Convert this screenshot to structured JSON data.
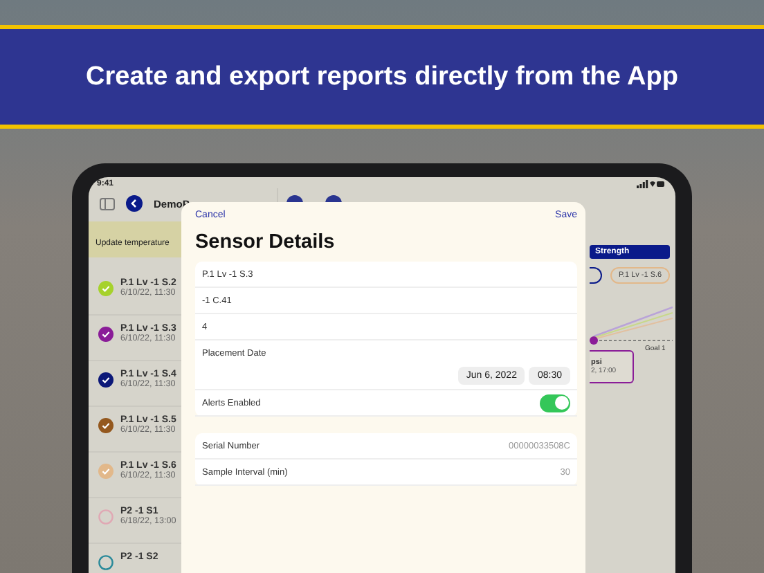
{
  "banner": {
    "title": "Create and export reports directly from the App"
  },
  "status_bar": {
    "time": "9:41"
  },
  "sidebar": {
    "title": "DemoP",
    "notice": "Update temperature",
    "sensors": [
      {
        "name": "P.1 Lv -1 S.2",
        "date": "6/10/22, 11:30",
        "color": "#a6d22c",
        "checked": true
      },
      {
        "name": "P.1 Lv -1 S.3",
        "date": "6/10/22, 11:30",
        "color": "#8a1c98",
        "checked": true
      },
      {
        "name": "P.1 Lv -1 S.4",
        "date": "6/10/22, 11:30",
        "color": "#0c1878",
        "checked": true
      },
      {
        "name": "P.1 Lv -1 S.5",
        "date": "6/10/22, 11:30",
        "color": "#94581e",
        "checked": true
      },
      {
        "name": "P.1 Lv -1 S.6",
        "date": "6/10/22, 11:30",
        "color": "#e2b88a",
        "checked": true
      },
      {
        "name": "P2 -1 S1",
        "date": "6/18/22, 13:00",
        "color": "#e0a8b4",
        "checked": false
      },
      {
        "name": "P2 -1 S2",
        "color": "#2a8a9a",
        "checked": false
      }
    ]
  },
  "detail": {
    "segment": "Strength",
    "chip": "P.1 Lv -1 S.6",
    "goal_label": "Goal 1",
    "callout_value": "psi",
    "callout_time": "2, 17:00"
  },
  "sheet": {
    "cancel": "Cancel",
    "save": "Save",
    "title": "Sensor Details",
    "fields": [
      {
        "value": "P.1 Lv -1 S.3"
      },
      {
        "value": "-1 C.41"
      },
      {
        "value": "4"
      }
    ],
    "placement_label": "Placement Date",
    "date": "Jun 6, 2022",
    "time": "08:30",
    "alerts_label": "Alerts Enabled",
    "alerts_on": true,
    "info": [
      {
        "label": "Serial Number",
        "value": "00000033508C"
      },
      {
        "label": "Sample Interval (min)",
        "value": "30"
      }
    ]
  }
}
